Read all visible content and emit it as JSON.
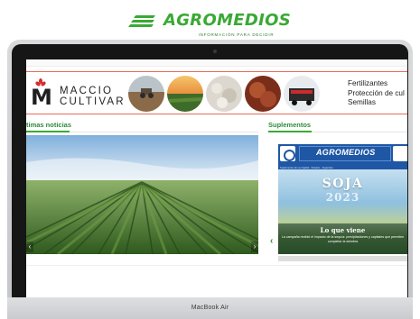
{
  "brand": {
    "name": "AGROMEDIOS",
    "tagline": "INFORMACIÓN PARA DECIDIR",
    "color": "#3aa935"
  },
  "device": {
    "label": "MacBook Air"
  },
  "ad": {
    "advertiser_line1": "MACCIO",
    "advertiser_line2": "CULTIVAR",
    "products": [
      "Fertilizantes",
      "Protección de cul",
      "Semillas"
    ],
    "accent_color": "#d42b2b"
  },
  "sections": {
    "news_title": "timas noticias",
    "supplements_title": "Suplementos"
  },
  "supplement": {
    "brand": "AGROMEDIOS",
    "meta": "Suplemento de La Capital · Rosario · Argentina",
    "headline": "SOJA",
    "year": "2023",
    "subtitle": "Lo que viene",
    "description": "La campaña recibió el impacto de la sequía: precipitaciones y capitales que permiten completar la siembra",
    "color": "#1f57a5"
  },
  "icons": {
    "prev_arrow": "chevron-left-icon",
    "next_arrow": "chevron-right-icon"
  }
}
